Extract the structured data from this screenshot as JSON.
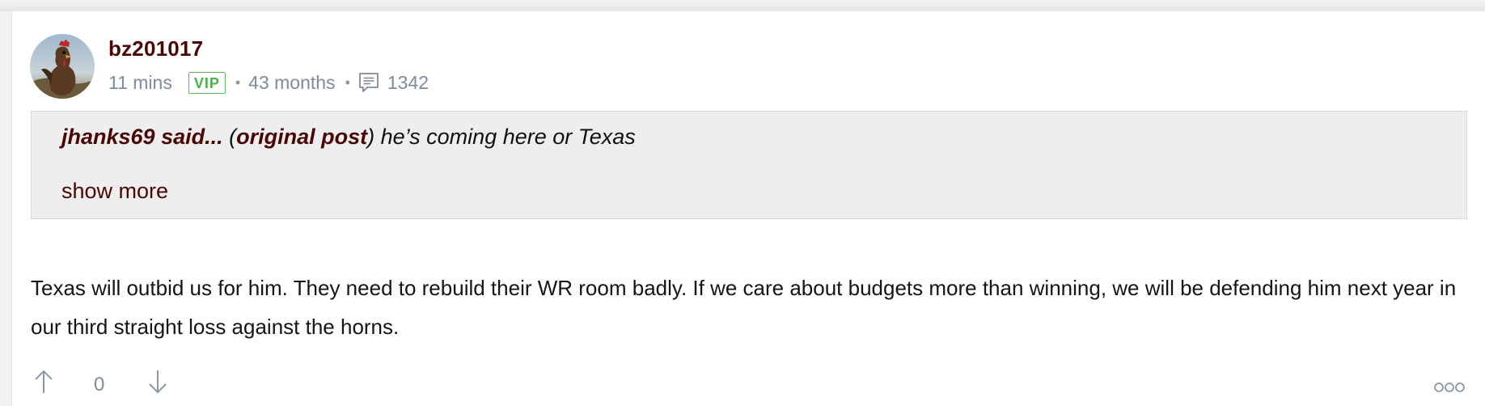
{
  "post": {
    "username": "bz201017",
    "time_ago": "11 mins",
    "badge": "VIP",
    "membership": "43 months",
    "post_count": "1342",
    "quote": {
      "author": "jhanks69 said...",
      "link_open": "(",
      "link_label": "original post",
      "link_close": ")",
      "text": " he’s coming here or Texas",
      "show_more_label": "show more"
    },
    "body": "Texas will outbid us for him. They need to rebuild their WR room badly. If we care about budgets more than winning, we will be defending him next year in our third straight loss against the horns.",
    "votes": {
      "count": "0",
      "up_icon": "arrow-up-icon",
      "down_icon": "arrow-down-icon"
    },
    "more_icon": "ellipsis-icon",
    "separator": "•"
  },
  "colors": {
    "brand": "#4a0505",
    "meta": "#7d8c99",
    "vip": "#4cae4c",
    "quote_bg": "#eeeeee"
  }
}
